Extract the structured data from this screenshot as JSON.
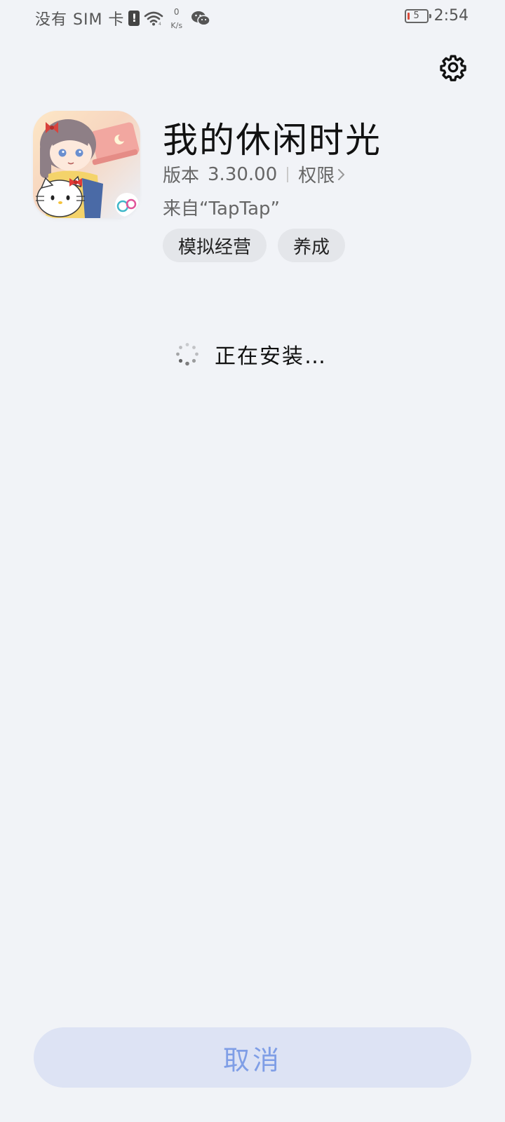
{
  "status_bar": {
    "carrier": "没有 SIM 卡",
    "sim_alert": "!",
    "net_speed_value": "0",
    "net_speed_unit": "K/s",
    "battery_level": "5",
    "time": "2:54"
  },
  "app": {
    "name": "我的休闲时光",
    "version_label": "版本",
    "version_value": "3.30.00",
    "permissions_label": "权限",
    "source": "来自“TapTap”",
    "tags": [
      "模拟经营",
      "养成"
    ]
  },
  "install": {
    "status_text": "正在安装…"
  },
  "actions": {
    "cancel_label": "取消"
  },
  "icons": {
    "settings": "gear-icon",
    "wifi": "wifi-icon",
    "wechat": "wechat-icon",
    "chevron": "chevron-right-icon",
    "spinner": "loading-spinner-icon"
  },
  "colors": {
    "background": "#f1f3f7",
    "tag_bg": "#e4e6ea",
    "cancel_bg": "#dde3f4",
    "cancel_text": "#7f9ee6",
    "battery_low": "#d94a3a"
  }
}
